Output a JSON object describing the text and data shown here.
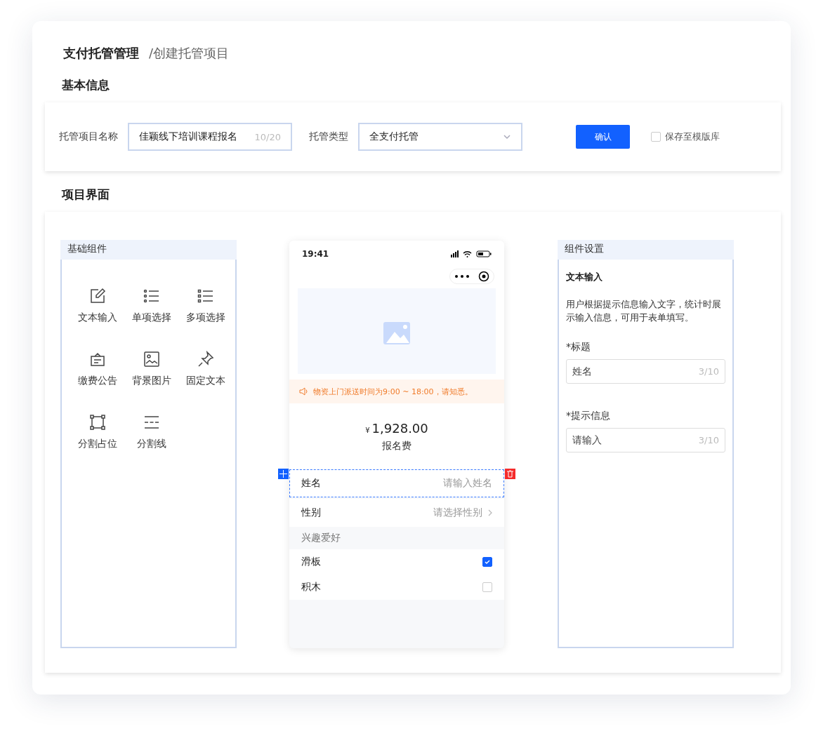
{
  "breadcrumb": {
    "root": "支付托管管理",
    "current": "/创建托管项目"
  },
  "basic_info": {
    "title": "基本信息",
    "name_label": "托管项目名称",
    "name_value": "佳颖线下培训课程报名",
    "name_count": "10/20",
    "type_label": "托管类型",
    "type_value": "全支付托管",
    "confirm": "确认",
    "save_template": {
      "label": "保存至模版库",
      "checked": false
    }
  },
  "project_ui": {
    "title": "项目界面",
    "palette": {
      "title": "基础组件",
      "items": [
        {
          "kind": "text",
          "label": "文本输入"
        },
        {
          "kind": "radio",
          "label": "单项选择"
        },
        {
          "kind": "multi",
          "label": "多项选择"
        },
        {
          "kind": "notice",
          "label": "缴费公告"
        },
        {
          "kind": "image",
          "label": "背景图片"
        },
        {
          "kind": "pin",
          "label": "固定文本"
        },
        {
          "kind": "frame",
          "label": "分割占位"
        },
        {
          "kind": "divider",
          "label": "分割线"
        }
      ]
    },
    "phone": {
      "time": "19:41",
      "notice": "物资上门派送时间为9:00 ~ 18:00，请知悉。",
      "currency": "¥",
      "price": "1,928.00",
      "price_label": "报名费",
      "rows": [
        {
          "kind": "input",
          "label": "姓名",
          "placeholder": "请输入姓名",
          "selected": true
        },
        {
          "kind": "select",
          "label": "性别",
          "placeholder": "请选择性别",
          "selected": false
        },
        {
          "kind": "group",
          "label": "兴趣爱好"
        },
        {
          "kind": "checkbox",
          "label": "滑板",
          "checked": true
        },
        {
          "kind": "checkbox",
          "label": "积木",
          "checked": false
        }
      ]
    },
    "settings": {
      "title": "组件设置",
      "component": "文本输入",
      "description": "用户根据提示信息输入文字，统计时展示输入信息，可用于表单填写。",
      "fields": [
        {
          "label": "*标题",
          "value": "姓名",
          "count": "3/10"
        },
        {
          "label": "*提示信息",
          "value": "请输入",
          "count": "3/10"
        }
      ]
    }
  }
}
